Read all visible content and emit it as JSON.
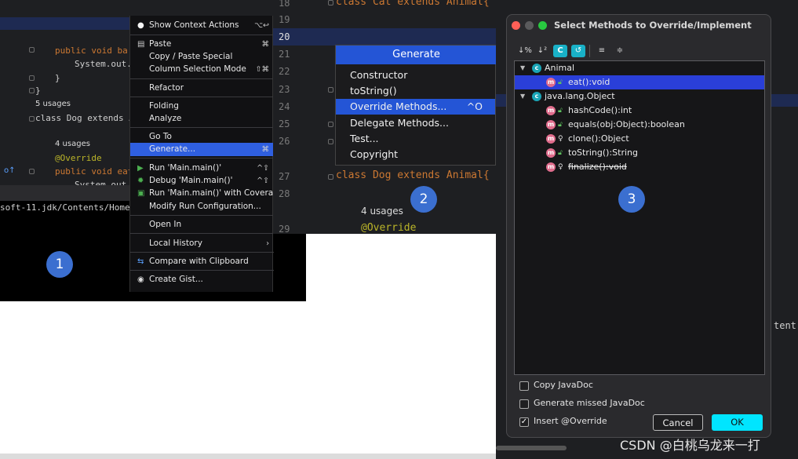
{
  "panel1": {
    "code": {
      "line1": "public  void ba",
      "line2": "System.out.",
      "line3": "}",
      "usages1": "5 usages",
      "class_line": "class Dog extends A",
      "usages2": "4 usages",
      "override": "@Override",
      "method_line": "public void eat",
      "system_line": "System.out",
      "path": "soft-11.jdk/Contents/Home/("
    },
    "context_menu": [
      {
        "label": "Show Context Actions",
        "shortcut": "⌥↩"
      },
      {
        "label": "Paste",
        "shortcut": "⌘"
      },
      {
        "label": "Copy / Paste Special",
        "shortcut": ""
      },
      {
        "label": "Column Selection Mode",
        "shortcut": "⇧⌘"
      },
      {
        "label": "Refactor",
        "shortcut": ""
      },
      {
        "label": "Folding",
        "shortcut": ""
      },
      {
        "label": "Analyze",
        "shortcut": ""
      },
      {
        "label": "Go To",
        "shortcut": ""
      },
      {
        "label": "Generate...",
        "shortcut": "⌘"
      },
      {
        "label": "Run 'Main.main()'",
        "shortcut": "^⇧"
      },
      {
        "label": "Debug 'Main.main()'",
        "shortcut": "^⇧"
      },
      {
        "label": "Run 'Main.main()' with Coverage",
        "shortcut": ""
      },
      {
        "label": "Modify Run Configuration...",
        "shortcut": ""
      },
      {
        "label": "Open In",
        "shortcut": ""
      },
      {
        "label": "Local History",
        "shortcut": "›"
      },
      {
        "label": "Compare with Clipboard",
        "shortcut": ""
      },
      {
        "label": "Create Gist...",
        "shortcut": ""
      }
    ],
    "badge": "1"
  },
  "panel2": {
    "line_numbers": [
      "18",
      "19",
      "20",
      "21",
      "22",
      "23",
      "24",
      "25",
      "26",
      "27",
      "28",
      "29"
    ],
    "code": {
      "line18": "class Cat extends Animal{",
      "line27": "class Dog extends Animal{",
      "usages": "4 usages",
      "override": "@Override"
    },
    "generate_popup": {
      "title": "Generate",
      "items": [
        {
          "label": "Constructor",
          "shortcut": ""
        },
        {
          "label": "toString()",
          "shortcut": ""
        },
        {
          "label": "Override Methods...",
          "shortcut": "^O"
        },
        {
          "label": "Delegate Methods...",
          "shortcut": ""
        },
        {
          "label": "Test...",
          "shortcut": ""
        },
        {
          "label": "Copyright",
          "shortcut": ""
        }
      ]
    },
    "badge": "2"
  },
  "panel3": {
    "dialog_title": "Select Methods to Override/Implement",
    "toolbar": [
      "↓%",
      "↓²",
      "C",
      "↺",
      "≡",
      "≑"
    ],
    "tree": {
      "class1": "Animal",
      "class1_method": "eat():void",
      "class2": "java.lang.Object",
      "class2_methods": [
        "hashCode():int",
        "equals(obj:Object):boolean",
        "clone():Object",
        "toString():String",
        "finalize():void"
      ]
    },
    "options": [
      {
        "label": "Copy JavaDoc",
        "checked": false
      },
      {
        "label": "Generate missed JavaDoc",
        "checked": false
      },
      {
        "label": "Insert @Override",
        "checked": true
      }
    ],
    "cancel_label": "Cancel",
    "ok_label": "OK",
    "badge": "3",
    "bg_text": "tent"
  },
  "watermark": "CSDN @白桃乌龙来一打",
  "colors": {
    "selection": "#2455d6",
    "badge": "#3b6fd0",
    "ok_button": "#00e5ff",
    "editor_bg": "#1e1f22"
  }
}
